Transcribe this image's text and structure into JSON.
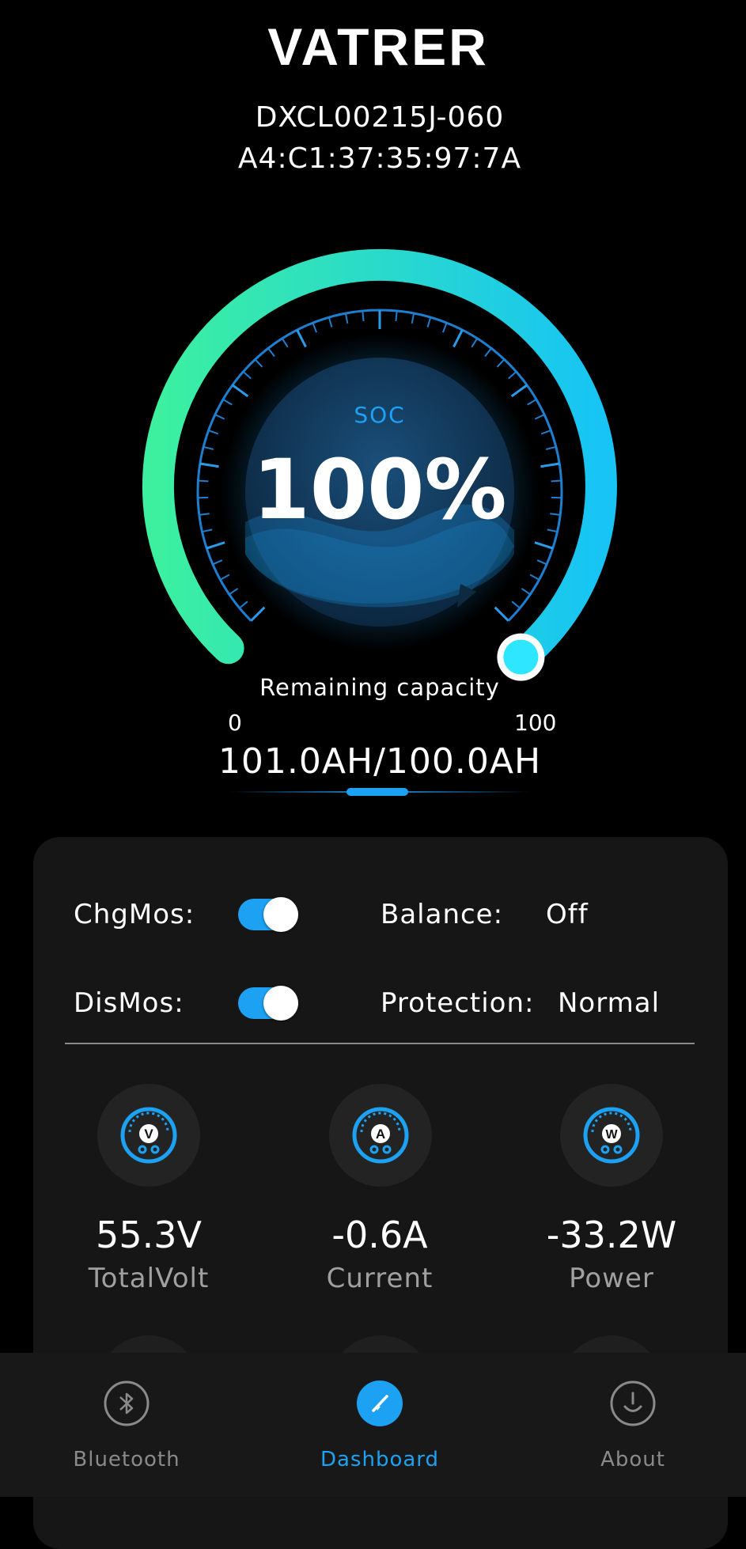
{
  "brand": "VATRER",
  "device": {
    "name": "DXCL00215J-060",
    "mac": "A4:C1:37:35:97:7A"
  },
  "gauge": {
    "soc_label": "SOC",
    "soc_value": "100%",
    "soc_percent": 100,
    "remaining_label": "Remaining capacity",
    "range_min": "0",
    "range_max": "100",
    "capacity": "101.0AH/100.0AH"
  },
  "status": {
    "chgmos_label": "ChgMos:",
    "chgmos_on": true,
    "dismos_label": "DisMos:",
    "dismos_on": true,
    "balance_label": "Balance:",
    "balance_value": "Off",
    "protection_label": "Protection:",
    "protection_value": "Normal"
  },
  "metrics": [
    {
      "icon": "voltmeter-icon",
      "glyph": "V",
      "value": "55.3V",
      "label": "TotalVolt"
    },
    {
      "icon": "ammeter-icon",
      "glyph": "A",
      "value": "-0.6A",
      "label": "Current"
    },
    {
      "icon": "wattmeter-icon",
      "glyph": "W",
      "value": "-33.2W",
      "label": "Power"
    }
  ],
  "tabs": [
    {
      "label": "Bluetooth",
      "icon": "bluetooth-icon",
      "active": false
    },
    {
      "label": "Dashboard",
      "icon": "dashboard-icon",
      "active": true
    },
    {
      "label": "About",
      "icon": "about-icon",
      "active": false
    }
  ],
  "colors": {
    "accent": "#1da1f2",
    "arc_start": "#3cf0a0",
    "arc_end": "#17c4f5",
    "inactive": "#8a8a8a"
  }
}
